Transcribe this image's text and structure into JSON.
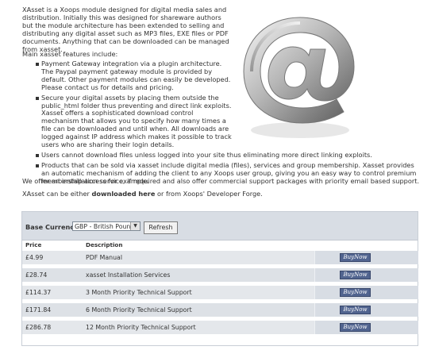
{
  "intro": {
    "paragraph": "XAsset is a Xoops module designed for digital media sales and distribution. Initially this was designed for shareware authors but the module architecture has been extended to selling and distributing any digital asset such as MP3 files, EXE files or PDF documents. Anything that can be downloaded can be managed from xasset."
  },
  "features": {
    "title": "Main xasset features include:",
    "items": [
      "Payment Gateway integration via a plugin architecture. The Paypal payment gateway module is provided by default. Other payment modules can easily be developed. Please contact us for details and pricing.",
      "Secure your digital assets by placing them outside the public_html folder thus preventing and direct link exploits. Xasset offers a sophisticated download control mechanism that allows you to specify how many times a file can be downloaded and until when. All downloads are logged against IP address which makes it possible to track users who are sharing their login details.",
      "Users cannot download files unless logged into your site thus eliminating more direct linking exploits.",
      "Products that can be sold via xasset include digital media (files), services and group membership. Xasset provides an automatic mechanism of adding the client to any Xoops user group, giving you an easy way to control premium membership access for example."
    ]
  },
  "support_line": "We offer an installation service, if required and also offer commercial support packages with priority email based support.",
  "download_line": {
    "prefix": "XAsset can be either ",
    "link": "downloaded here",
    "suffix": " or from Xoops' Developer Forge."
  },
  "currency": {
    "label": "Base Currency :",
    "selected": "GBP - British Pound",
    "refresh_label": "Refresh"
  },
  "table": {
    "headers": [
      "Price",
      "Description"
    ],
    "rows": [
      {
        "price": "£4.99",
        "description": "PDF Manual",
        "buy": "BuyNow"
      },
      {
        "price": "£28.74",
        "description": "xasset Installation Services",
        "buy": "BuyNow"
      },
      {
        "price": "£114.37",
        "description": "3 Month Priority Technical Support",
        "buy": "BuyNow"
      },
      {
        "price": "£171.84",
        "description": "6 Month Priority Technical Support",
        "buy": "BuyNow"
      },
      {
        "price": "£286.78",
        "description": "12 Month Priority Technical Support",
        "buy": "BuyNow"
      }
    ]
  },
  "graphic": {
    "icon": "at-sign-logo-icon",
    "color": "#9a9a9a"
  }
}
